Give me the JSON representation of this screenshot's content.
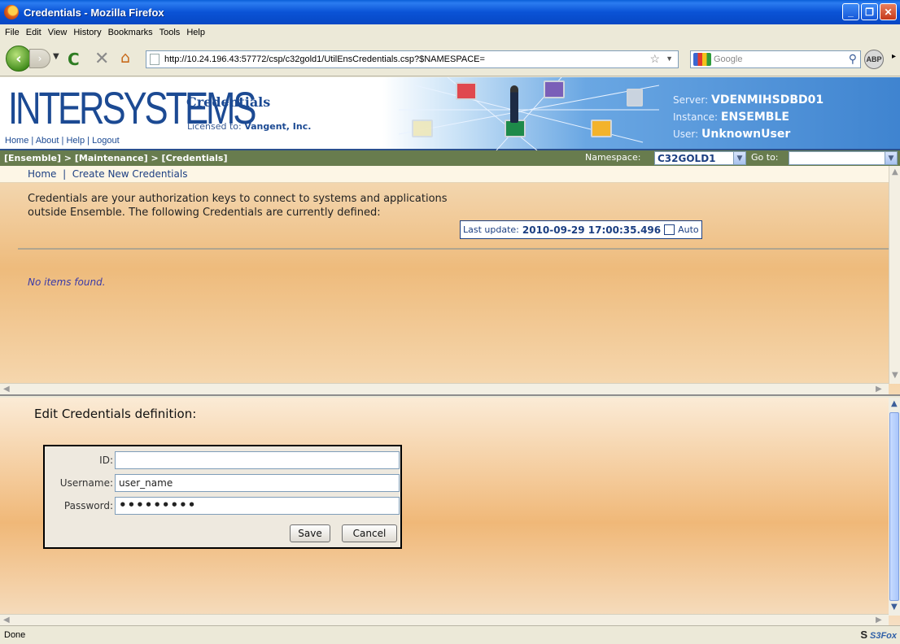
{
  "window": {
    "title": "Credentials - Mozilla Firefox"
  },
  "menu": [
    "File",
    "Edit",
    "View",
    "History",
    "Bookmarks",
    "Tools",
    "Help"
  ],
  "browser": {
    "url": "http://10.24.196.43:57772/csp/c32gold1/UtilEnsCredentials.csp?$NAMESPACE=",
    "search_placeholder": "Google",
    "abp_label": "ABP"
  },
  "banner": {
    "logo": "INTERSYSTEMS",
    "links": [
      "Home",
      "About",
      "Help",
      "Logout"
    ],
    "title": "Credentials",
    "licensed_label": "Licensed to:",
    "licensed_value": "Vangent, Inc.",
    "server_label": "Server:",
    "server_value": "VDENMIHSDBD01",
    "instance_label": "Instance:",
    "instance_value": "ENSEMBLE",
    "user_label": "User:",
    "user_value": "UnknownUser"
  },
  "breadcrumb": "[Ensemble] > [Maintenance] > [Credentials]",
  "namespace": {
    "label": "Namespace:",
    "value": "C32GOLD1",
    "goto_label": "Go to:"
  },
  "top": {
    "nav_home": "Home",
    "nav_create": "Create New Credentials",
    "intro": "Credentials are your authorization keys to connect to systems and applications outside Ensemble. The following Credentials are currently defined:",
    "last_update_label": "Last update:",
    "last_update_value": "2010-09-29 17:00:35.496",
    "auto_label": "Auto",
    "empty_message": "No items found."
  },
  "edit": {
    "title": "Edit Credentials definition:",
    "id_label": "ID:",
    "id_value": "",
    "username_label": "Username:",
    "username_value": "user_name",
    "password_label": "Password:",
    "password_value": "•••••••••",
    "save_label": "Save",
    "cancel_label": "Cancel"
  },
  "status": {
    "text": "Done",
    "addon": "S3Fox"
  },
  "colors": {
    "titlebar": "#0a53d6",
    "banner_text": "#1c4a93",
    "crumbbar": "#687c4e",
    "frame_orange": "#eebb7c"
  }
}
